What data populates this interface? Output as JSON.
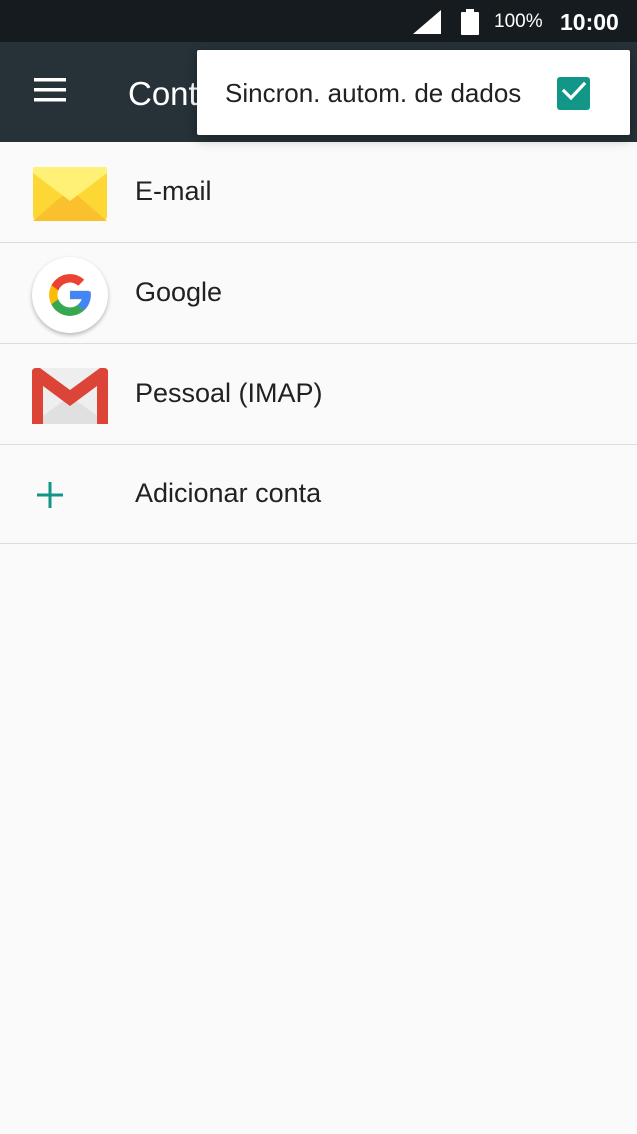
{
  "status_bar": {
    "battery_text": "100%",
    "time": "10:00",
    "icons": [
      "signal-icon",
      "battery-icon"
    ]
  },
  "app_bar": {
    "title": "Contas",
    "menu_icon": "hamburger-menu-icon"
  },
  "accounts": [
    {
      "label": "E-mail",
      "icon": "email-envelope-icon"
    },
    {
      "label": "Google",
      "icon": "google-logo-icon"
    },
    {
      "label": "Pessoal (IMAP)",
      "icon": "gmail-logo-icon"
    },
    {
      "label": "Adicionar conta",
      "icon": "plus-icon"
    }
  ],
  "overflow_menu": {
    "items": [
      {
        "label": "Sincron. autom. de dados",
        "checked": true
      }
    ]
  },
  "colors": {
    "status_bar": "#151b1f",
    "app_bar": "#263238",
    "accent": "#129688",
    "background": "#fafafa"
  }
}
